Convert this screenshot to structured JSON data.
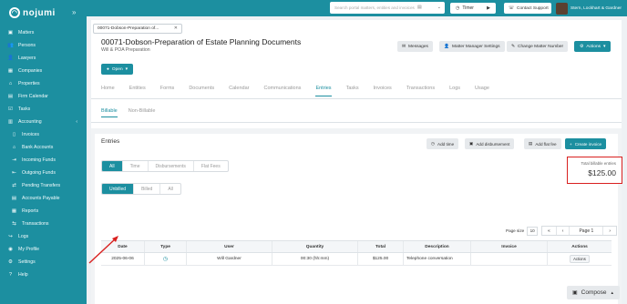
{
  "brand": {
    "name": "nojumi"
  },
  "sidebar": {
    "items": [
      {
        "label": "Matters",
        "icon": "briefcase-icon",
        "glyph": "▣"
      },
      {
        "label": "Persons",
        "icon": "people-icon",
        "glyph": "👥"
      },
      {
        "label": "Lawyers",
        "icon": "person-icon",
        "glyph": "👤"
      },
      {
        "label": "Companies",
        "icon": "building-icon",
        "glyph": "▦"
      },
      {
        "label": "Properties",
        "icon": "home-icon",
        "glyph": "⌂"
      },
      {
        "label": "Firm Calendar",
        "icon": "calendar-icon",
        "glyph": "▤"
      },
      {
        "label": "Tasks",
        "icon": "tasks-icon",
        "glyph": "☑"
      },
      {
        "label": "Accounting",
        "icon": "calculator-icon",
        "glyph": "▥",
        "chevron": "‹"
      },
      {
        "label": "Invoices",
        "icon": "invoice-icon",
        "glyph": "▯",
        "sub": true
      },
      {
        "label": "Bank Accounts",
        "icon": "bank-icon",
        "glyph": "⌂",
        "sub": true
      },
      {
        "label": "Incoming Funds",
        "icon": "arrow-in-icon",
        "glyph": "⇥",
        "sub": true
      },
      {
        "label": "Outgoing Funds",
        "icon": "arrow-out-icon",
        "glyph": "⇤",
        "sub": true
      },
      {
        "label": "Pending Transfers",
        "icon": "transfer-icon",
        "glyph": "⇄",
        "sub": true
      },
      {
        "label": "Accounts Payable",
        "icon": "payable-icon",
        "glyph": "▤",
        "sub": true
      },
      {
        "label": "Reports",
        "icon": "report-icon",
        "glyph": "▦",
        "sub": true
      },
      {
        "label": "Transactions",
        "icon": "transactions-icon",
        "glyph": "⇆",
        "sub": true
      },
      {
        "label": "Logs",
        "icon": "logs-icon",
        "glyph": "↪"
      },
      {
        "label": "My Profile",
        "icon": "user-circle-icon",
        "glyph": "◉"
      },
      {
        "label": "Settings",
        "icon": "gear-icon",
        "glyph": "⚙"
      },
      {
        "label": "Help",
        "icon": "help-icon",
        "glyph": "?"
      }
    ]
  },
  "topbar": {
    "search_placeholder": "Search portal matters, entities and invoices",
    "timer_label": "Timer",
    "support_label": "Contact Support",
    "user_name": "Stern, Lockhart & Gardner"
  },
  "matter": {
    "tab_label": "00071-Dobson-Preparation of...",
    "title": "00071-Dobson-Preparation of Estate Planning Documents",
    "subtitle": "Will & POA Preparation",
    "buttons": {
      "messages": "Messages",
      "manager_settings": "Matter Manager Settings",
      "change_number": "Change Matter Number",
      "actions": "Actions"
    },
    "status_label": "Open"
  },
  "tabs": [
    "Home",
    "Entities",
    "Forms",
    "Documents",
    "Calendar",
    "Communications",
    "Entries",
    "Tasks",
    "Invoices",
    "Transactions",
    "Logs",
    "Usage"
  ],
  "active_tab": "Entries",
  "subtabs": [
    "Billable",
    "Non-Billable"
  ],
  "entries": {
    "title": "Entries",
    "buttons": {
      "add_time": "Add time",
      "add_disbursement": "Add disbursement",
      "add_flat_fee": "Add flat fee",
      "create_invoice": "Create invoice"
    },
    "type_filters": [
      "All",
      "Time",
      "Disbursements",
      "Flat Fees"
    ],
    "billing_filters": [
      "Unbilled",
      "Billed",
      "All"
    ],
    "total_label": "Total billable entries",
    "total_value": "$125.00",
    "pager": {
      "page_size_label": "Page size",
      "page_size": "10",
      "first": "«",
      "prev": "‹",
      "page_label": "Page 1",
      "next": "›"
    },
    "columns": [
      "Date",
      "Type",
      "User",
      "Quantity",
      "Total",
      "Description",
      "Invoice",
      "Actions"
    ],
    "rows": [
      {
        "date": "2025-06-06",
        "type_icon": "clock-icon",
        "user": "Will Gardner",
        "quantity": "00:30 (hh:mm)",
        "total": "$125.00",
        "description": "Telephone conversation",
        "invoice": "",
        "actions": "Actions"
      }
    ]
  },
  "compose_label": "Compose",
  "colors": {
    "brand": "#1c8fa0",
    "highlight": "#d9201f"
  }
}
